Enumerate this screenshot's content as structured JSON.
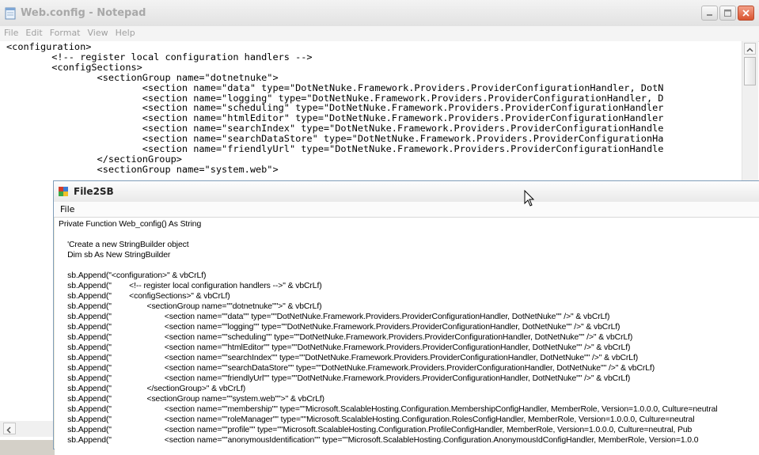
{
  "notepad": {
    "title": "Web.config - Notepad",
    "menu": [
      "File",
      "Edit",
      "Format",
      "View",
      "Help"
    ],
    "content": "<configuration>\n        <!-- register local configuration handlers -->\n        <configSections>\n                <sectionGroup name=\"dotnetnuke\">\n                        <section name=\"data\" type=\"DotNetNuke.Framework.Providers.ProviderConfigurationHandler, DotN\n                        <section name=\"logging\" type=\"DotNetNuke.Framework.Providers.ProviderConfigurationHandler, D\n                        <section name=\"scheduling\" type=\"DotNetNuke.Framework.Providers.ProviderConfigurationHandler\n                        <section name=\"htmlEditor\" type=\"DotNetNuke.Framework.Providers.ProviderConfigurationHandler\n                        <section name=\"searchIndex\" type=\"DotNetNuke.Framework.Providers.ProviderConfigurationHandle\n                        <section name=\"searchDataStore\" type=\"DotNetNuke.Framework.Providers.ProviderConfigurationHa\n                        <section name=\"friendlyUrl\" type=\"DotNetNuke.Framework.Providers.ProviderConfigurationHandle\n                </sectionGroup>\n                <sectionGroup name=\"system.web\">"
  },
  "file2sb": {
    "title": "File2SB",
    "menu": [
      "File"
    ],
    "content": "Private Function Web_config() As String\n\n    'Create a new StringBuilder object\n    Dim sb As New StringBuilder\n\n    sb.Append(\"<configuration>\" & vbCrLf)\n    sb.Append(\"        <!-- register local configuration handlers -->\" & vbCrLf)\n    sb.Append(\"        <configSections>\" & vbCrLf)\n    sb.Append(\"                <sectionGroup name=\"\"dotnetnuke\"\">\" & vbCrLf)\n    sb.Append(\"                        <section name=\"\"data\"\" type=\"\"DotNetNuke.Framework.Providers.ProviderConfigurationHandler, DotNetNuke\"\" />\" & vbCrLf)\n    sb.Append(\"                        <section name=\"\"logging\"\" type=\"\"DotNetNuke.Framework.Providers.ProviderConfigurationHandler, DotNetNuke\"\" />\" & vbCrLf)\n    sb.Append(\"                        <section name=\"\"scheduling\"\" type=\"\"DotNetNuke.Framework.Providers.ProviderConfigurationHandler, DotNetNuke\"\" />\" & vbCrLf)\n    sb.Append(\"                        <section name=\"\"htmlEditor\"\" type=\"\"DotNetNuke.Framework.Providers.ProviderConfigurationHandler, DotNetNuke\"\" />\" & vbCrLf)\n    sb.Append(\"                        <section name=\"\"searchIndex\"\" type=\"\"DotNetNuke.Framework.Providers.ProviderConfigurationHandler, DotNetNuke\"\" />\" & vbCrLf)\n    sb.Append(\"                        <section name=\"\"searchDataStore\"\" type=\"\"DotNetNuke.Framework.Providers.ProviderConfigurationHandler, DotNetNuke\"\" />\" & vbCrLf)\n    sb.Append(\"                        <section name=\"\"friendlyUrl\"\" type=\"\"DotNetNuke.Framework.Providers.ProviderConfigurationHandler, DotNetNuke\"\" />\" & vbCrLf)\n    sb.Append(\"                </sectionGroup>\" & vbCrLf)\n    sb.Append(\"                <sectionGroup name=\"\"system.web\"\">\" & vbCrLf)\n    sb.Append(\"                        <section name=\"\"membership\"\" type=\"\"Microsoft.ScalableHosting.Configuration.MembershipConfigHandler, MemberRole, Version=1.0.0.0, Culture=neutral\n    sb.Append(\"                        <section name=\"\"roleManager\"\" type=\"\"Microsoft.ScalableHosting.Configuration.RolesConfigHandler, MemberRole, Version=1.0.0.0, Culture=neutral\n    sb.Append(\"                        <section name=\"\"profile\"\" type=\"\"Microsoft.ScalableHosting.Configuration.ProfileConfigHandler, MemberRole, Version=1.0.0.0, Culture=neutral, Pub\n    sb.Append(\"                        <section name=\"\"anonymousIdentification\"\" type=\"\"Microsoft.ScalableHosting.Configuration.AnonymousIdConfigHandler, MemberRole, Version=1.0.0"
  },
  "colors": {
    "notepad_title_inactive": "#a8a8a8",
    "close_button": "#d9532f"
  }
}
